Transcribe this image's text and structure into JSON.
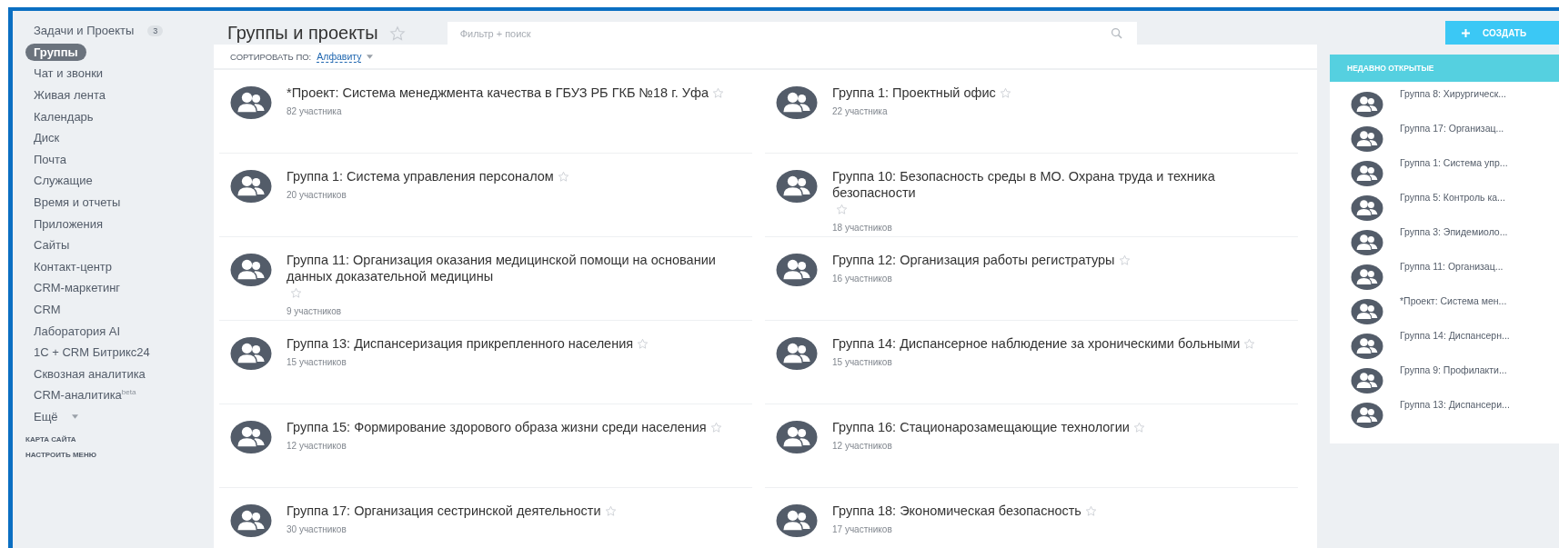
{
  "sidebar": {
    "items": [
      {
        "label": "Задачи и Проекты",
        "badge": "3",
        "selected": false
      },
      {
        "label": "Группы",
        "selected": true
      },
      {
        "label": "Чат и звонки",
        "selected": false
      },
      {
        "label": "Живая лента",
        "selected": false
      },
      {
        "label": "Календарь",
        "selected": false
      },
      {
        "label": "Диск",
        "selected": false
      },
      {
        "label": "Почта",
        "selected": false
      },
      {
        "label": "Служащие",
        "selected": false
      },
      {
        "label": "Время и отчеты",
        "selected": false
      },
      {
        "label": "Приложения",
        "selected": false
      },
      {
        "label": "Сайты",
        "selected": false
      },
      {
        "label": "Контакт-центр",
        "selected": false
      },
      {
        "label": "CRM-маркетинг",
        "selected": false
      },
      {
        "label": "CRM",
        "selected": false
      },
      {
        "label": "Лаборатория AI",
        "selected": false
      },
      {
        "label": "1С + CRM Битрикс24",
        "selected": false
      },
      {
        "label": "Сквозная аналитика",
        "selected": false
      },
      {
        "label": "CRM-аналитика$^{beta}$",
        "selected": false
      },
      {
        "label": "Ещё",
        "dropdown": true,
        "selected": false
      }
    ],
    "links": [
      "КАРТА САЙТА",
      "НАСТРОИТЬ МЕНЮ"
    ]
  },
  "header": {
    "title": "Группы и проекты",
    "search": {
      "placeholder": "Фильтр + поиск"
    },
    "create_button": "СОЗДАТЬ"
  },
  "sort": {
    "label": "СОРТИРОВАТЬ ПО:",
    "value": "Алфавиту"
  },
  "groups": [
    {
      "name": "*Проект: Система менеджмента качества в ГБУЗ РБ ГКБ №18 г. Уфа",
      "members": "82 участника"
    },
    {
      "name": "Группа 1: Проектный офис",
      "members": "22 участника"
    },
    {
      "name": "Группа 1: Система управления персоналом",
      "members": "20 участников"
    },
    {
      "name": "Группа 10: Безопасность среды в МО. Охрана труда и техника безопасности",
      "members": "18 участников"
    },
    {
      "name": "Группа 11: Организация оказания медицинской помощи на основании данных доказательной медицины",
      "members": "9 участников"
    },
    {
      "name": "Группа 12: Организация работы регистратуры",
      "members": "16 участников"
    },
    {
      "name": "Группа 13: Диспансеризация прикрепленного населения",
      "members": "15 участников"
    },
    {
      "name": "Группа 14: Диспансерное наблюдение за хроническими больными",
      "members": "15 участников"
    },
    {
      "name": "Группа 15: Формирование здорового образа жизни среди населения",
      "members": "12 участников"
    },
    {
      "name": "Группа 16: Стационарозамещающие технологии",
      "members": "12 участников"
    },
    {
      "name": "Группа 17: Организация сестринской деятельности",
      "members": "30 участников"
    },
    {
      "name": "Группа 18: Экономическая безопасность",
      "members": "17 участников"
    }
  ],
  "recent": {
    "title": "НЕДАВНО ОТКРЫТЫЕ",
    "items": [
      "Группа 8: Хирургическ...",
      "Группа 17: Организац...",
      "Группа 1: Система упр...",
      "Группа 5: Контроль ка...",
      "Группа 3: Эпидемиоло...",
      "Группа 11: Организац...",
      "*Проект: Система мен...",
      "Группа 14: Диспансерн...",
      "Группа 9: Профилакти...",
      "Группа 13: Диспансери..."
    ]
  }
}
